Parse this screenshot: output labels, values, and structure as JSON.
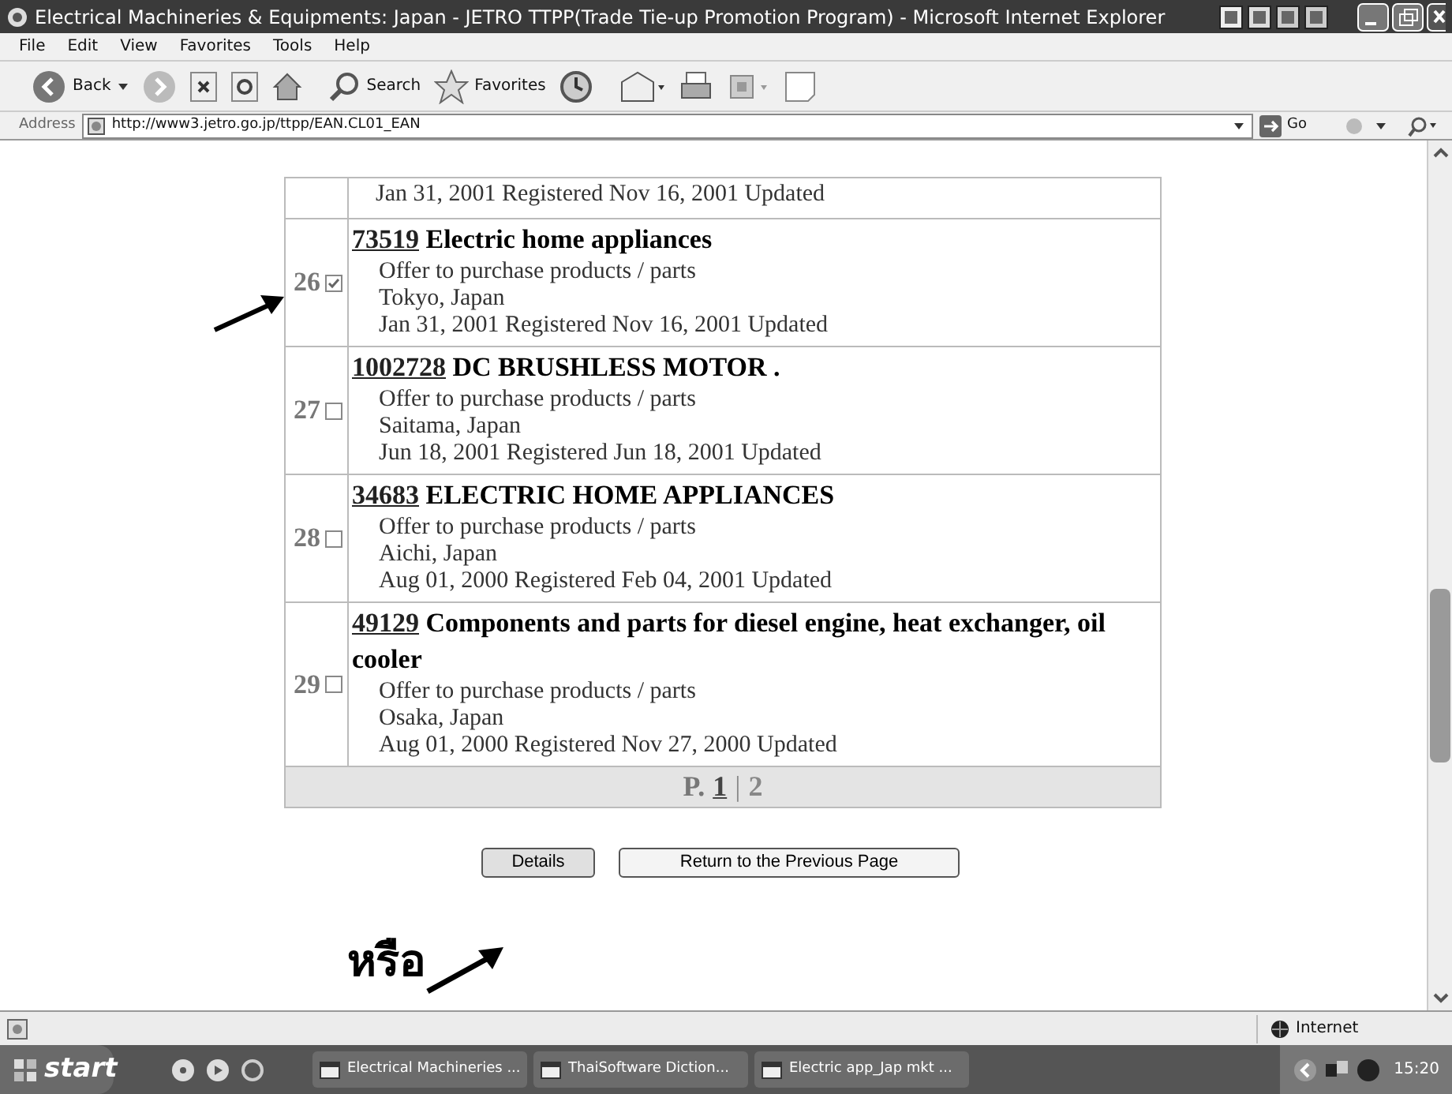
{
  "window": {
    "title": "Electrical Machineries & Equipments: Japan - JETRO TTPP(Trade Tie-up Promotion Program) - Microsoft Internet Explorer"
  },
  "menu": [
    "File",
    "Edit",
    "View",
    "Favorites",
    "Tools",
    "Help"
  ],
  "toolbar": {
    "back": "Back",
    "search": "Search",
    "favorites": "Favorites"
  },
  "address_bar": {
    "label": "Address",
    "url": "http://www3.jetro.go.jp/ttpp/EAN.CL01_EAN",
    "go": "Go"
  },
  "top_fragment": {
    "dates": "Jan 31, 2001 Registered Nov 16, 2001 Updated"
  },
  "listings": [
    {
      "number": "26",
      "checked": true,
      "id": "73519",
      "title": "Electric home appliances",
      "offer": "Offer to purchase products / parts",
      "location": "Tokyo, Japan",
      "dates": "Jan 31, 2001 Registered Nov 16, 2001 Updated"
    },
    {
      "number": "27",
      "checked": false,
      "id": "1002728",
      "title": "DC BRUSHLESS MOTOR .",
      "offer": "Offer to purchase products / parts",
      "location": "Saitama, Japan",
      "dates": "Jun 18, 2001 Registered Jun 18, 2001 Updated"
    },
    {
      "number": "28",
      "checked": false,
      "id": "34683",
      "title": "ELECTRIC HOME APPLIANCES",
      "offer": "Offer to purchase products / parts",
      "location": "Aichi, Japan",
      "dates": "Aug 01, 2000 Registered Feb 04, 2001 Updated"
    },
    {
      "number": "29",
      "checked": false,
      "id": "49129",
      "title": "Components and parts for diesel engine, heat exchanger, oil cooler",
      "offer": "Offer to purchase products / parts",
      "location": "Osaka, Japan",
      "dates": "Aug 01, 2000 Registered Nov 27, 2000 Updated"
    }
  ],
  "pagination": {
    "prefix": "P.",
    "separator": "|",
    "pages": [
      {
        "label": "1",
        "selected": true
      },
      {
        "label": "2",
        "selected": false
      }
    ]
  },
  "buttons": [
    "Details",
    "Return to the Previous Page"
  ],
  "annotation": "หรือ",
  "status_bar": {
    "zone": "Internet"
  },
  "taskbar": {
    "start": "start",
    "tasks": [
      "Electrical Machineries ...",
      "ThaiSoftware Diction...",
      "Electric app_Jap mkt ..."
    ],
    "clock": "15:20"
  }
}
